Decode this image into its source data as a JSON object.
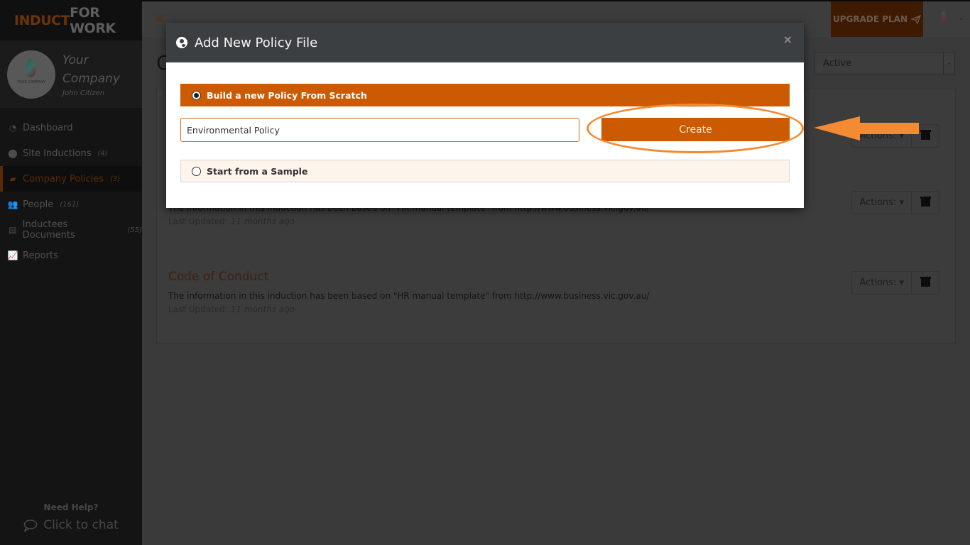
{
  "brand": {
    "part1": "INDUCT",
    "part2": "FOR WORK"
  },
  "profile": {
    "company": "Your Company",
    "company_line1": "Your",
    "company_line2": "Company",
    "user": "John Citizen",
    "logo_text": "YOUR COMPANY"
  },
  "sidebar": {
    "items": [
      {
        "label": "Dashboard",
        "count": "",
        "icon": "dashboard-icon"
      },
      {
        "label": "Site Inductions",
        "count": "(4)",
        "icon": "map-marker-icon"
      },
      {
        "label": "Company Policies",
        "count": "(3)",
        "icon": "book-icon",
        "active": true
      },
      {
        "label": "People",
        "count": "(161)",
        "icon": "users-icon"
      },
      {
        "label": "Inductees Documents",
        "count": "(55)",
        "icon": "document-icon"
      },
      {
        "label": "Reports",
        "count": "",
        "icon": "line-chart-icon"
      }
    ],
    "help_title": "Need Help?",
    "chat_label": "Click to chat"
  },
  "topbar": {
    "upgrade_label": "UPGRADE PLAN",
    "menu_icon": "≡"
  },
  "page": {
    "title_initial": "C",
    "status_filter": "Active"
  },
  "policies": [
    {
      "title": "",
      "description": "",
      "last_updated_label": "",
      "last_updated": "",
      "actions_label": "Actions:"
    },
    {
      "title": "",
      "description": "The information in this induction has been based on \"HR manual template\" from http://www.business.vic.gov.au/",
      "last_updated_label": "Last Updated:",
      "last_updated": "11 months ago",
      "actions_label": "Actions:"
    },
    {
      "title": "Code of Conduct",
      "description": "The information in this induction has been based on \"HR manual template\" from http://www.business.vic.gov.au/",
      "last_updated_label": "Last Updated:",
      "last_updated": "11 months ago",
      "actions_label": "Actions:"
    }
  ],
  "modal": {
    "title": "Add New Policy File",
    "close": "×",
    "option_scratch": "Build a new Policy From Scratch",
    "option_sample": "Start from a Sample",
    "policy_name_value": "Environmental Policy",
    "create_label": "Create"
  },
  "colors": {
    "accent": "#cb5a03",
    "annotation": "#f48a32",
    "modal_header": "#3c3f41"
  }
}
